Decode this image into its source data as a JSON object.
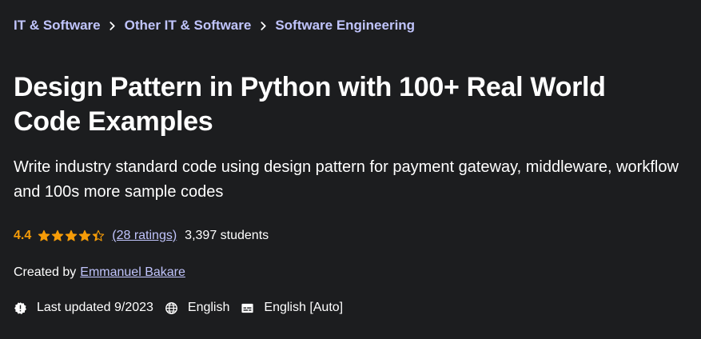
{
  "breadcrumb": {
    "items": [
      "IT & Software",
      "Other IT & Software",
      "Software Engineering"
    ]
  },
  "course": {
    "title": "Design Pattern in Python with 100+ Real World Code Examples",
    "subtitle": "Write industry standard code using design pattern for payment gateway, middleware, workflow and 100s more sample codes",
    "rating": "4.4",
    "rating_stars": 4.4,
    "ratings_count": "(28 ratings)",
    "students": "3,397 students",
    "created_by_label": "Created by",
    "author": "Emmanuel Bakare",
    "last_updated": "Last updated 9/2023",
    "language": "English",
    "captions": "English [Auto]"
  },
  "colors": {
    "background": "#1c1d1f",
    "link": "#c0c4fc",
    "rating": "#f69c08",
    "text": "#ffffff"
  },
  "icons": {
    "breadcrumb_separator": "chevron-right-icon",
    "rating": "star-icon",
    "last_updated": "alert-badge-icon",
    "language": "globe-icon",
    "captions": "closed-captions-icon"
  }
}
